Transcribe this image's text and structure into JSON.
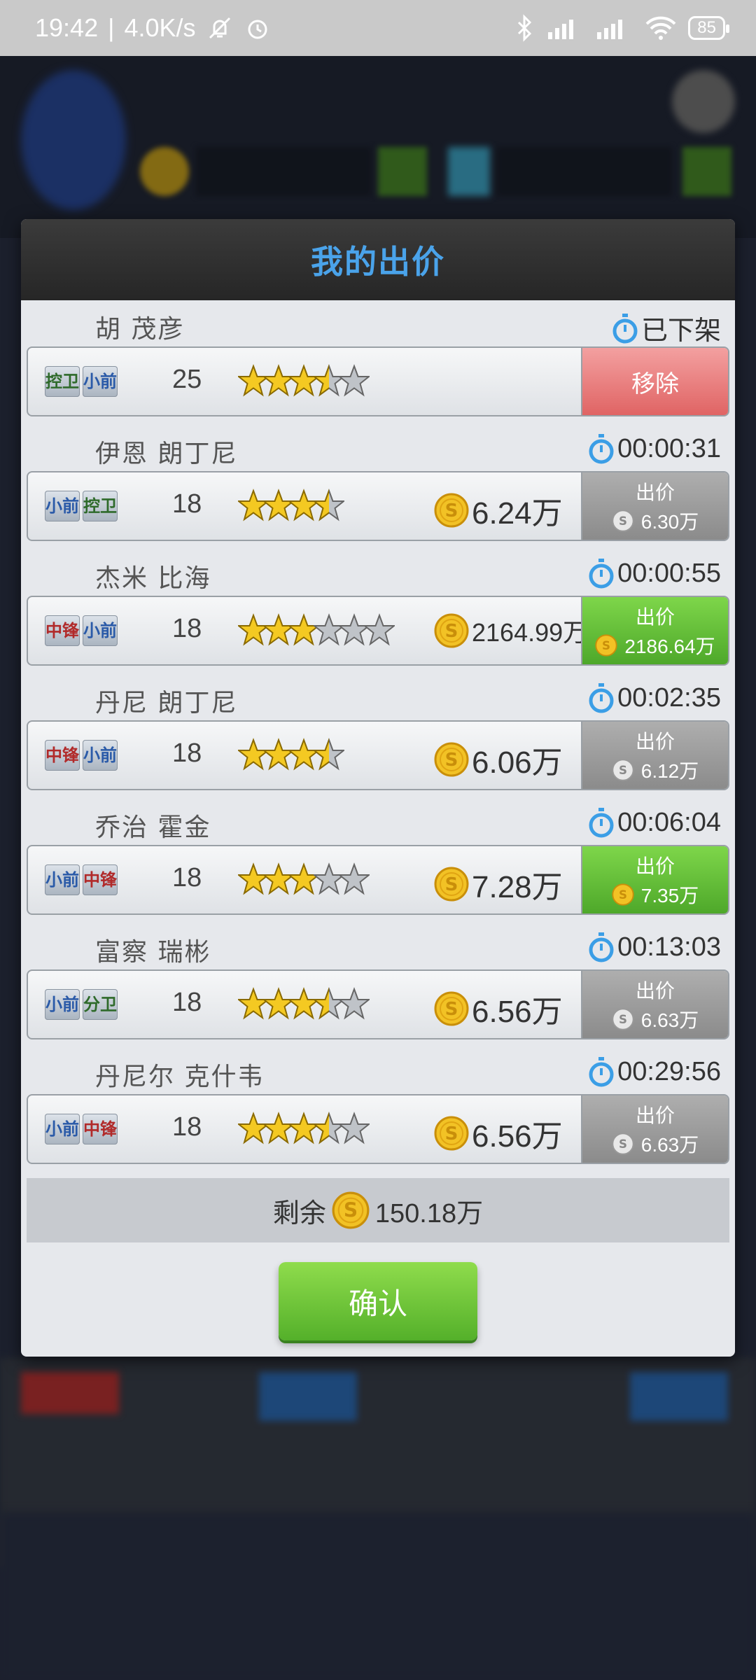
{
  "status_bar": {
    "time": "19:42",
    "net_speed": "4.0K/s",
    "battery": "85"
  },
  "dialog": {
    "title": "我的出价",
    "bids": [
      {
        "name": "胡 茂彦",
        "status": "已下架",
        "positions": [
          {
            "label": "控卫",
            "color": "green"
          },
          {
            "label": "小前",
            "color": "blue"
          }
        ],
        "age": "25",
        "stars": 3.5,
        "star_slots": 5,
        "price": "",
        "action": "移除",
        "action_style": "red",
        "bid_price": ""
      },
      {
        "name": "伊恩 朗丁尼",
        "status": "00:00:31",
        "positions": [
          {
            "label": "小前",
            "color": "blue"
          },
          {
            "label": "控卫",
            "color": "green"
          }
        ],
        "age": "18",
        "stars": 3.5,
        "star_slots": 4,
        "price": "6.24万",
        "action": "出价",
        "action_style": "gray",
        "bid_price": "6.30万"
      },
      {
        "name": "杰米 比海",
        "status": "00:00:55",
        "positions": [
          {
            "label": "中锋",
            "color": "red"
          },
          {
            "label": "小前",
            "color": "blue"
          }
        ],
        "age": "18",
        "stars": 3,
        "star_slots": 6,
        "price": "2164.99万",
        "action": "出价",
        "action_style": "green",
        "bid_price": "2186.64万"
      },
      {
        "name": "丹尼 朗丁尼",
        "status": "00:02:35",
        "positions": [
          {
            "label": "中锋",
            "color": "red"
          },
          {
            "label": "小前",
            "color": "blue"
          }
        ],
        "age": "18",
        "stars": 3.5,
        "star_slots": 4,
        "price": "6.06万",
        "action": "出价",
        "action_style": "gray",
        "bid_price": "6.12万"
      },
      {
        "name": "乔治 霍金",
        "status": "00:06:04",
        "positions": [
          {
            "label": "小前",
            "color": "blue"
          },
          {
            "label": "中锋",
            "color": "red"
          }
        ],
        "age": "18",
        "stars": 3,
        "star_slots": 5,
        "price": "7.28万",
        "action": "出价",
        "action_style": "green",
        "bid_price": "7.35万"
      },
      {
        "name": "富察 瑞彬",
        "status": "00:13:03",
        "positions": [
          {
            "label": "小前",
            "color": "blue"
          },
          {
            "label": "分卫",
            "color": "green"
          }
        ],
        "age": "18",
        "stars": 3.5,
        "star_slots": 5,
        "price": "6.56万",
        "action": "出价",
        "action_style": "gray",
        "bid_price": "6.63万"
      },
      {
        "name": "丹尼尔 克什韦",
        "status": "00:29:56",
        "positions": [
          {
            "label": "小前",
            "color": "blue"
          },
          {
            "label": "中锋",
            "color": "red"
          }
        ],
        "age": "18",
        "stars": 3.5,
        "star_slots": 5,
        "price": "6.56万",
        "action": "出价",
        "action_style": "gray",
        "bid_price": "6.63万"
      }
    ],
    "remaining_label": "剩余",
    "remaining_value": "150.18万",
    "confirm_label": "确认"
  }
}
